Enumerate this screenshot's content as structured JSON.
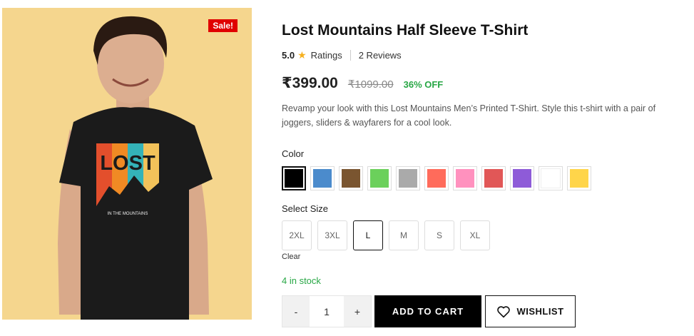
{
  "product": {
    "sale_badge": "Sale!",
    "title": "Lost Mountains Half Sleeve T-Shirt",
    "rating": "5.0",
    "ratings_label": "Ratings",
    "reviews_label": "2 Reviews",
    "price": "₹399.00",
    "old_price": "₹1099.00",
    "discount": "36% OFF",
    "description": "Revamp your look with this Lost Mountains Men’s Printed T-Shirt. Style this t-shirt with a pair of joggers, sliders & wayfarers for a cool look.",
    "shirt_print_text": "LOST",
    "shirt_print_subtext": "IN THE MOUNTAINS"
  },
  "color": {
    "label": "Color",
    "swatches": [
      "#000000",
      "#4b8bcc",
      "#7a5530",
      "#6bd05b",
      "#aaaaaa",
      "#ff6b5b",
      "#ff91be",
      "#e15757",
      "#8e5bd8",
      "#ffffff",
      "#ffd54a"
    ],
    "selected_index": 0
  },
  "size": {
    "label": "Select Size",
    "options": [
      "2XL",
      "3XL",
      "L",
      "M",
      "S",
      "XL"
    ],
    "selected_index": 2,
    "clear_label": "Clear"
  },
  "stock": {
    "text": "4 in stock"
  },
  "cart": {
    "minus": "-",
    "quantity": "1",
    "plus": "+",
    "add_label": "ADD TO CART",
    "wishlist_label": "WISHLIST"
  }
}
